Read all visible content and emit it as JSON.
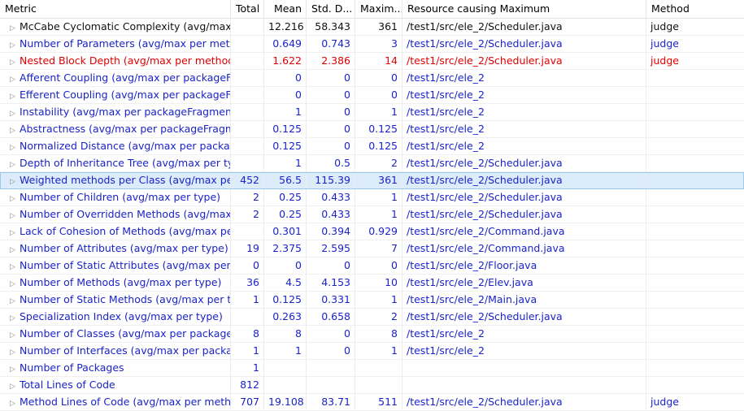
{
  "columns": {
    "metric": "Metric",
    "total": "Total",
    "mean": "Mean",
    "std": "Std. D...",
    "maximum": "Maxim...",
    "resource": "Resource causing Maximum",
    "method": "Method"
  },
  "expander_glyph": "▷",
  "colors": {
    "default": "#1a23c8",
    "highlight": "#e00000",
    "first": "#111111",
    "selected_bg": "#dcecfb"
  },
  "rows": [
    {
      "metric": "McCabe Cyclomatic Complexity (avg/max",
      "total": "",
      "mean": "12.216",
      "std": "58.343",
      "max": "361",
      "resource": "/test1/src/ele_2/Scheduler.java",
      "method": "judge",
      "color": "black"
    },
    {
      "metric": "Number of Parameters (avg/max per meth",
      "total": "",
      "mean": "0.649",
      "std": "0.743",
      "max": "3",
      "resource": "/test1/src/ele_2/Scheduler.java",
      "method": "judge",
      "color": "blue"
    },
    {
      "metric": "Nested Block Depth (avg/max per method",
      "total": "",
      "mean": "1.622",
      "std": "2.386",
      "max": "14",
      "resource": "/test1/src/ele_2/Scheduler.java",
      "method": "judge",
      "color": "red"
    },
    {
      "metric": "Afferent Coupling (avg/max per packageF",
      "total": "",
      "mean": "0",
      "std": "0",
      "max": "0",
      "resource": "/test1/src/ele_2",
      "method": "",
      "color": "blue"
    },
    {
      "metric": "Efferent Coupling (avg/max per packageFr",
      "total": "",
      "mean": "0",
      "std": "0",
      "max": "0",
      "resource": "/test1/src/ele_2",
      "method": "",
      "color": "blue"
    },
    {
      "metric": "Instability (avg/max per packageFragment",
      "total": "",
      "mean": "1",
      "std": "0",
      "max": "1",
      "resource": "/test1/src/ele_2",
      "method": "",
      "color": "blue"
    },
    {
      "metric": "Abstractness (avg/max per packageFragm",
      "total": "",
      "mean": "0.125",
      "std": "0",
      "max": "0.125",
      "resource": "/test1/src/ele_2",
      "method": "",
      "color": "blue"
    },
    {
      "metric": "Normalized Distance (avg/max per packag",
      "total": "",
      "mean": "0.125",
      "std": "0",
      "max": "0.125",
      "resource": "/test1/src/ele_2",
      "method": "",
      "color": "blue"
    },
    {
      "metric": "Depth of Inheritance Tree (avg/max per ty",
      "total": "",
      "mean": "1",
      "std": "0.5",
      "max": "2",
      "resource": "/test1/src/ele_2/Scheduler.java",
      "method": "",
      "color": "blue"
    },
    {
      "metric": "Weighted methods per Class (avg/max pe",
      "total": "452",
      "mean": "56.5",
      "std": "115.39",
      "max": "361",
      "resource": "/test1/src/ele_2/Scheduler.java",
      "method": "",
      "color": "blue",
      "selected": true
    },
    {
      "metric": "Number of Children (avg/max per type)",
      "total": "2",
      "mean": "0.25",
      "std": "0.433",
      "max": "1",
      "resource": "/test1/src/ele_2/Scheduler.java",
      "method": "",
      "color": "blue"
    },
    {
      "metric": "Number of Overridden Methods (avg/max",
      "total": "2",
      "mean": "0.25",
      "std": "0.433",
      "max": "1",
      "resource": "/test1/src/ele_2/Scheduler.java",
      "method": "",
      "color": "blue"
    },
    {
      "metric": "Lack of Cohesion of Methods (avg/max pe",
      "total": "",
      "mean": "0.301",
      "std": "0.394",
      "max": "0.929",
      "resource": "/test1/src/ele_2/Command.java",
      "method": "",
      "color": "blue"
    },
    {
      "metric": "Number of Attributes (avg/max per type)",
      "total": "19",
      "mean": "2.375",
      "std": "2.595",
      "max": "7",
      "resource": "/test1/src/ele_2/Command.java",
      "method": "",
      "color": "blue"
    },
    {
      "metric": "Number of Static Attributes (avg/max per",
      "total": "0",
      "mean": "0",
      "std": "0",
      "max": "0",
      "resource": "/test1/src/ele_2/Floor.java",
      "method": "",
      "color": "blue"
    },
    {
      "metric": "Number of Methods (avg/max per type)",
      "total": "36",
      "mean": "4.5",
      "std": "4.153",
      "max": "10",
      "resource": "/test1/src/ele_2/Elev.java",
      "method": "",
      "color": "blue"
    },
    {
      "metric": "Number of Static Methods (avg/max per t",
      "total": "1",
      "mean": "0.125",
      "std": "0.331",
      "max": "1",
      "resource": "/test1/src/ele_2/Main.java",
      "method": "",
      "color": "blue"
    },
    {
      "metric": "Specialization Index (avg/max per type)",
      "total": "",
      "mean": "0.263",
      "std": "0.658",
      "max": "2",
      "resource": "/test1/src/ele_2/Scheduler.java",
      "method": "",
      "color": "blue"
    },
    {
      "metric": "Number of Classes (avg/max per package",
      "total": "8",
      "mean": "8",
      "std": "0",
      "max": "8",
      "resource": "/test1/src/ele_2",
      "method": "",
      "color": "blue"
    },
    {
      "metric": "Number of Interfaces (avg/max per packa",
      "total": "1",
      "mean": "1",
      "std": "0",
      "max": "1",
      "resource": "/test1/src/ele_2",
      "method": "",
      "color": "blue"
    },
    {
      "metric": "Number of Packages",
      "total": "1",
      "mean": "",
      "std": "",
      "max": "",
      "resource": "",
      "method": "",
      "color": "blue"
    },
    {
      "metric": "Total Lines of Code",
      "total": "812",
      "mean": "",
      "std": "",
      "max": "",
      "resource": "",
      "method": "",
      "color": "blue"
    },
    {
      "metric": "Method Lines of Code (avg/max per meth",
      "total": "707",
      "mean": "19.108",
      "std": "83.71",
      "max": "511",
      "resource": "/test1/src/ele_2/Scheduler.java",
      "method": "judge",
      "color": "blue"
    }
  ]
}
